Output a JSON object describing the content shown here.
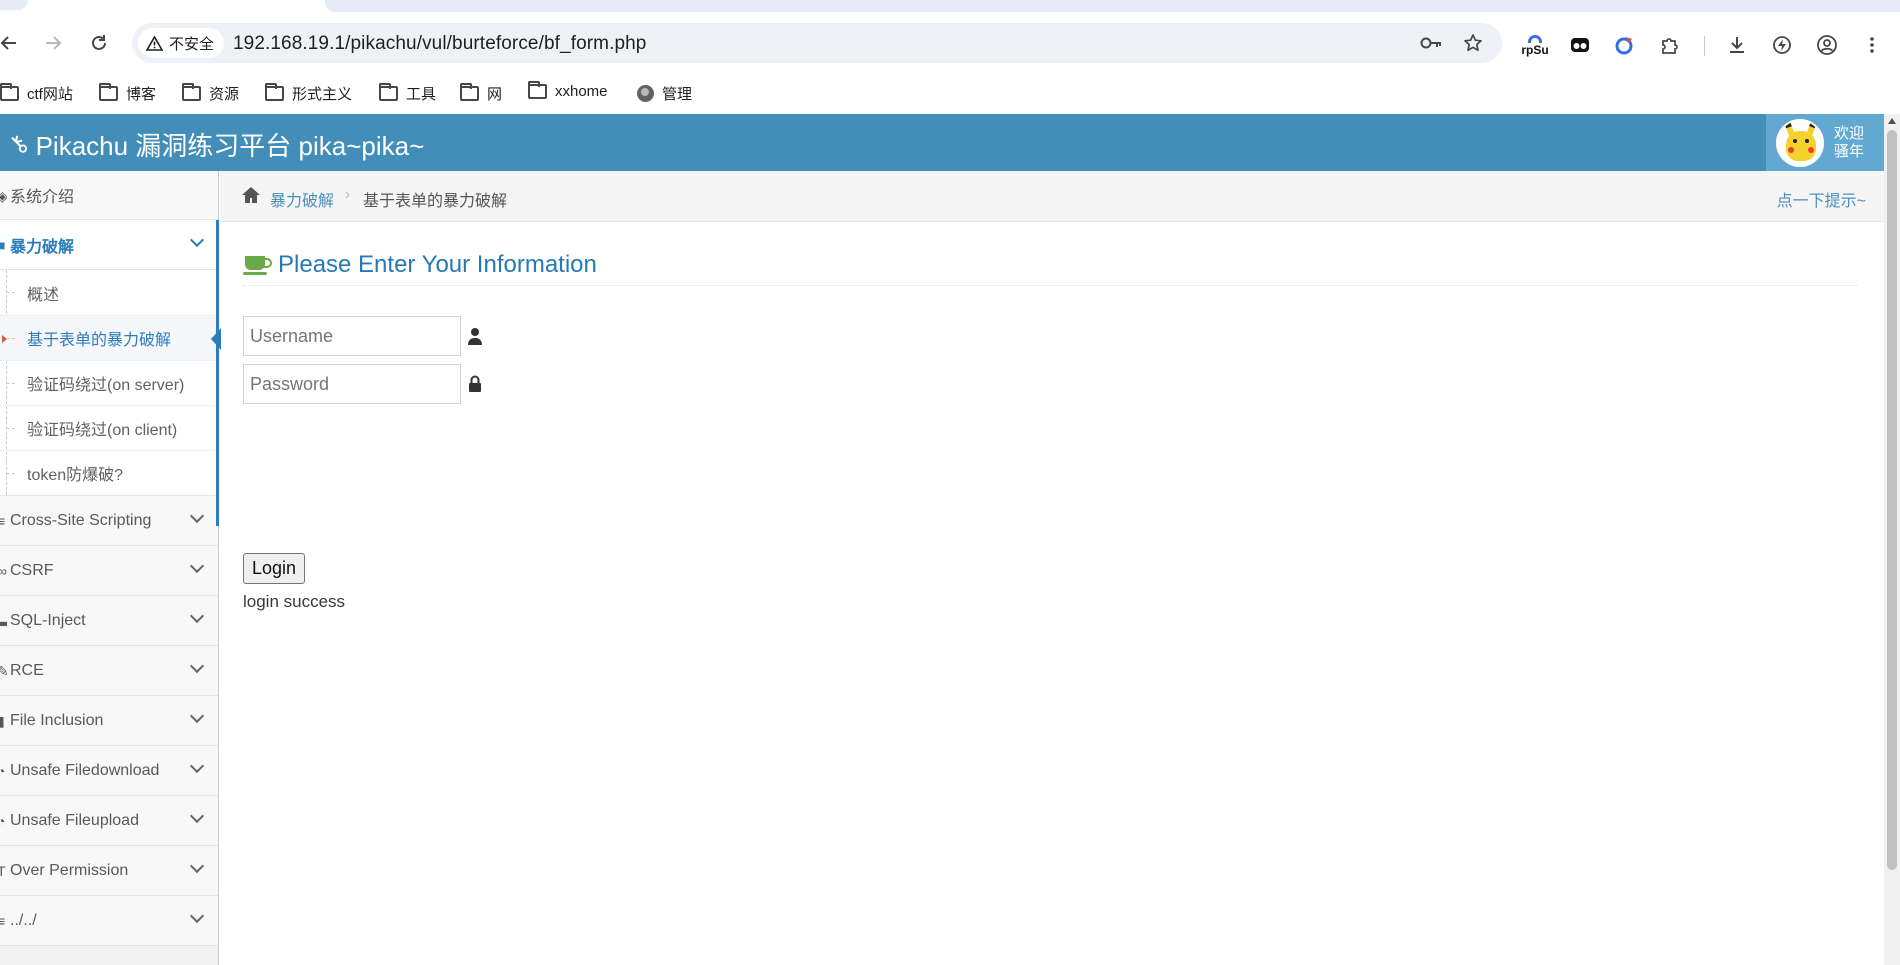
{
  "browser": {
    "security_label": "不安全",
    "url": "192.168.19.1/pikachu/vul/burteforce/bf_form.php",
    "extensions": [
      "rpSu",
      "tampermonkey-icon",
      "edge-ext-icon",
      "puzzle-icon",
      "download-icon",
      "lightning-icon",
      "profile-icon",
      "menu-icon"
    ],
    "ext_rpsu_label": "rpSu",
    "bookmarks": [
      {
        "label": "ctf网站",
        "icon": "folder-icon"
      },
      {
        "label": "博客",
        "icon": "folder-icon"
      },
      {
        "label": "资源",
        "icon": "folder-icon"
      },
      {
        "label": "形式主义",
        "icon": "folder-icon"
      },
      {
        "label": "工具",
        "icon": "folder-icon"
      },
      {
        "label": "网",
        "icon": "folder-icon"
      },
      {
        "label": "xxhome",
        "icon": "folder-icon"
      },
      {
        "label": "管理",
        "icon": "globe-icon"
      }
    ]
  },
  "header": {
    "title": "Pikachu 漏洞练习平台 pika~pika~",
    "welcome_line1": "欢迎",
    "welcome_line2": "骚年",
    "color": "#438eb9"
  },
  "sidebar": {
    "items": [
      {
        "label": "系统介绍",
        "icon": "desktop-icon"
      },
      {
        "label": "暴力破解",
        "icon": "lock-icon",
        "open": true
      },
      {
        "label": "Cross-Site Scripting",
        "icon": "list-icon"
      },
      {
        "label": "CSRF",
        "icon": "link-icon"
      },
      {
        "label": "SQL-Inject",
        "icon": "fax-icon"
      },
      {
        "label": "RCE",
        "icon": "wrench-icon"
      },
      {
        "label": "File Inclusion",
        "icon": "file-icon"
      },
      {
        "label": "Unsafe Filedownload",
        "icon": "clock-icon"
      },
      {
        "label": "Unsafe Fileupload",
        "icon": "clock-icon"
      },
      {
        "label": "Over Permission",
        "icon": "text-icon"
      },
      {
        "label": "../../",
        "icon": "folder-icon"
      }
    ],
    "submenu": [
      {
        "label": "概述"
      },
      {
        "label": "基于表单的暴力破解",
        "active": true
      },
      {
        "label": "验证码绕过(on server)"
      },
      {
        "label": "验证码绕过(on client)"
      },
      {
        "label": "token防爆破?"
      }
    ]
  },
  "breadcrumb": {
    "link": "暴力破解",
    "separator": "›",
    "current": "基于表单的暴力破解",
    "hint": "点一下提示~"
  },
  "form": {
    "title": "Please Enter Your Information",
    "username_placeholder": "Username",
    "password_placeholder": "Password",
    "login_label": "Login",
    "status": "login success"
  }
}
